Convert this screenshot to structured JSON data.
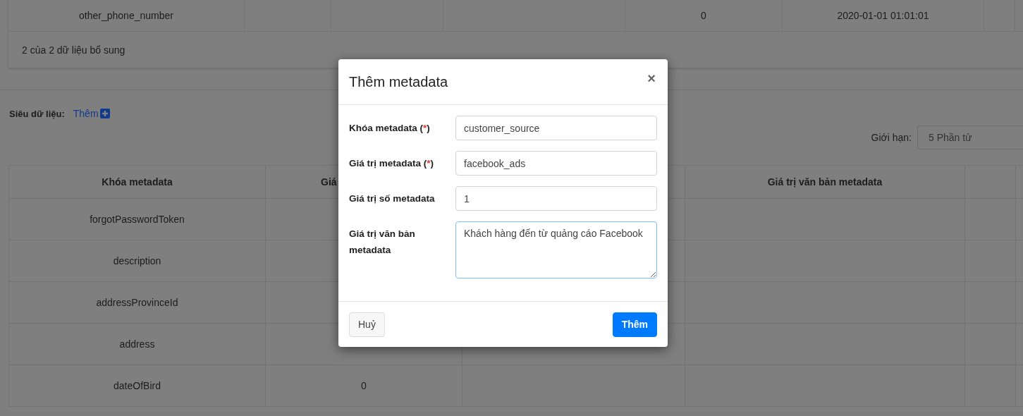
{
  "top_table": {
    "row": {
      "column_1": "other_phone_number",
      "column_5": "0",
      "column_6": "2020-01-01 01:01:01"
    },
    "footer": "2 của 2 dữ liệu bổ sung"
  },
  "metadata_section": {
    "label": "Siêu dữ liệu:",
    "add_link": "Thêm",
    "limit_label": "Giới hạn:",
    "limit_value": "5 Phần tử"
  },
  "table": {
    "columns": [
      {
        "label": "Khóa metadata"
      },
      {
        "label": "Giá"
      },
      {},
      {
        "label": "Giá trị văn bản metadata"
      },
      {}
    ],
    "rows": [
      {
        "cells": [
          "forgotPasswordToken"
        ]
      },
      {
        "cells": [
          "description"
        ]
      },
      {
        "cells": [
          "addressProvinceId"
        ]
      },
      {
        "cells": [
          "address"
        ]
      },
      {
        "cells": [
          "dateOfBird",
          "0"
        ]
      }
    ]
  },
  "modal": {
    "title": "Thêm metadata",
    "close": "×",
    "fields": [
      {
        "kind": "input",
        "label_parts": [
          "Khóa metadata (",
          "*",
          ")"
        ],
        "value": "customer_source",
        "focused": false
      },
      {
        "kind": "input",
        "label_parts": [
          "Giá trị metadata (",
          "*",
          ")"
        ],
        "value": "facebook_ads",
        "focused": false
      },
      {
        "kind": "input",
        "label_parts": [
          "Giá trị số metadata"
        ],
        "value": "1",
        "focused": false
      },
      {
        "kind": "textarea",
        "label_parts": [
          "Giá trị văn bản metadata"
        ],
        "value": "Khách hàng đến từ quảng cáo Facebook",
        "focused": true
      }
    ],
    "buttons": [
      {
        "kind": "secondary",
        "label": "Huỷ"
      },
      {
        "kind": "primary",
        "label": "Thêm"
      }
    ]
  }
}
